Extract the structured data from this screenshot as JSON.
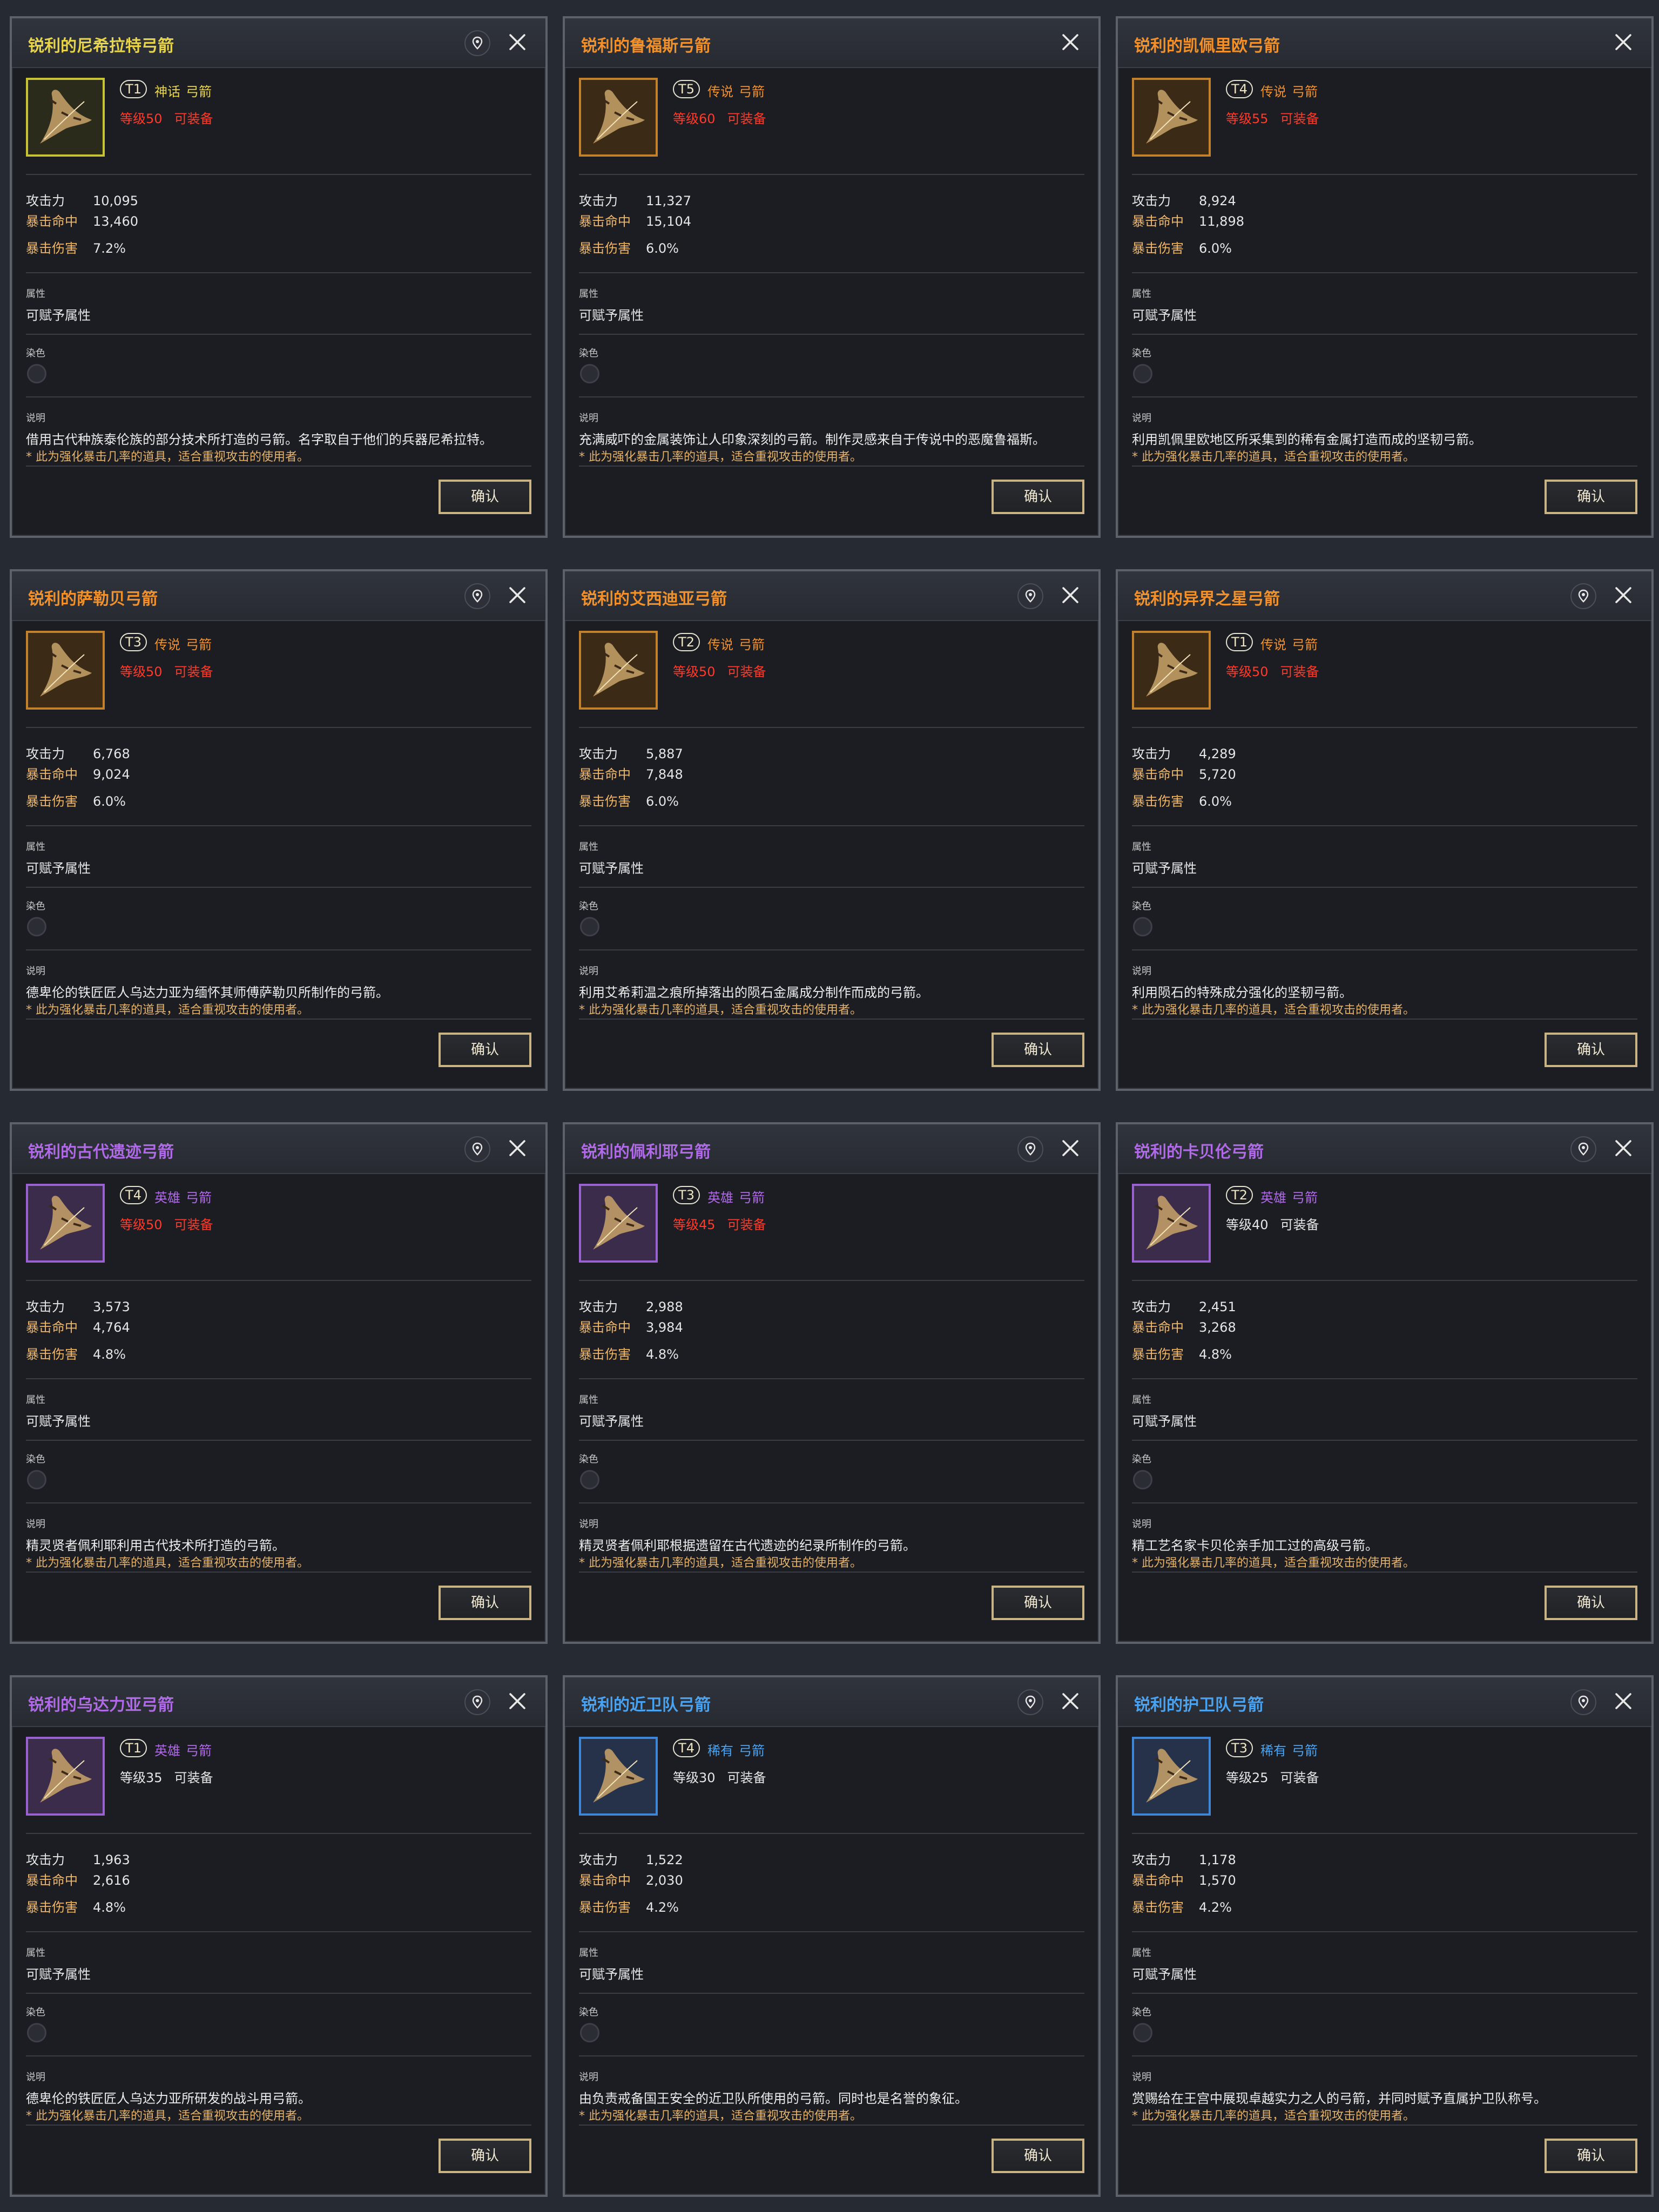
{
  "colors": {
    "mythic": "#e8d44a",
    "legendary": "#f2902a",
    "heroic": "#b06ae8",
    "rare": "#4aa3f0",
    "level_unmet": "#ff3a2a",
    "level_met": "#e6e6e6",
    "stat_atk": "#e6e6e6",
    "stat_crit": "#f0b768"
  },
  "labels": {
    "attack": "攻击力",
    "crit_hit": "暴击命中",
    "crit_damage": "暴击伤害",
    "property": "属性",
    "property_value": "可赋予属性",
    "dye": "染色",
    "description": "说明",
    "note": "* 此为强化暴击几率的道具，适合重视攻击的使用者。",
    "equippable": "可装备",
    "confirm": "确认",
    "type": "弓箭"
  },
  "icons": {
    "pin": "map-pin-icon",
    "close": "close-icon",
    "item": "bow-icon"
  },
  "cards": [
    {
      "title": "锐利的尼希拉特弓箭",
      "grade": "mythic",
      "tier": "T1",
      "grade_label": "神话",
      "level": "等级50",
      "level_met": false,
      "attack": "10,095",
      "crit_hit": "13,460",
      "crit_damage": "7.2%",
      "desc": "借用古代种族泰伦族的部分技术所打造的弓箭。名字取自于他们的兵器尼希拉特。",
      "pin": true
    },
    {
      "title": "锐利的鲁福斯弓箭",
      "grade": "legendary",
      "tier": "T5",
      "grade_label": "传说",
      "level": "等级60",
      "level_met": false,
      "attack": "11,327",
      "crit_hit": "15,104",
      "crit_damage": "6.0%",
      "desc": "充满威吓的金属装饰让人印象深刻的弓箭。制作灵感来自于传说中的恶魔鲁福斯。",
      "pin": false
    },
    {
      "title": "锐利的凯佩里欧弓箭",
      "grade": "legendary",
      "tier": "T4",
      "grade_label": "传说",
      "level": "等级55",
      "level_met": false,
      "attack": "8,924",
      "crit_hit": "11,898",
      "crit_damage": "6.0%",
      "desc": "利用凯佩里欧地区所采集到的稀有金属打造而成的坚韧弓箭。",
      "pin": false
    },
    {
      "title": "锐利的萨勒贝弓箭",
      "grade": "legendary",
      "tier": "T3",
      "grade_label": "传说",
      "level": "等级50",
      "level_met": false,
      "attack": "6,768",
      "crit_hit": "9,024",
      "crit_damage": "6.0%",
      "desc": "德卑伦的铁匠匠人乌达力亚为缅怀其师傅萨勒贝所制作的弓箭。",
      "pin": true
    },
    {
      "title": "锐利的艾西迪亚弓箭",
      "grade": "legendary",
      "tier": "T2",
      "grade_label": "传说",
      "level": "等级50",
      "level_met": false,
      "attack": "5,887",
      "crit_hit": "7,848",
      "crit_damage": "6.0%",
      "desc": "利用艾希莉温之痕所掉落出的陨石金属成分制作而成的弓箭。",
      "pin": true
    },
    {
      "title": "锐利的异界之星弓箭",
      "grade": "legendary",
      "tier": "T1",
      "grade_label": "传说",
      "level": "等级50",
      "level_met": false,
      "attack": "4,289",
      "crit_hit": "5,720",
      "crit_damage": "6.0%",
      "desc": "利用陨石的特殊成分强化的坚韧弓箭。",
      "pin": true
    },
    {
      "title": "锐利的古代遗迹弓箭",
      "grade": "heroic",
      "tier": "T4",
      "grade_label": "英雄",
      "level": "等级50",
      "level_met": false,
      "attack": "3,573",
      "crit_hit": "4,764",
      "crit_damage": "4.8%",
      "desc": "精灵贤者佩利耶利用古代技术所打造的弓箭。",
      "pin": true
    },
    {
      "title": "锐利的佩利耶弓箭",
      "grade": "heroic",
      "tier": "T3",
      "grade_label": "英雄",
      "level": "等级45",
      "level_met": false,
      "attack": "2,988",
      "crit_hit": "3,984",
      "crit_damage": "4.8%",
      "desc": "精灵贤者佩利耶根据遗留在古代遗迹的纪录所制作的弓箭。",
      "pin": true
    },
    {
      "title": "锐利的卡贝伦弓箭",
      "grade": "heroic",
      "tier": "T2",
      "grade_label": "英雄",
      "level": "等级40",
      "level_met": true,
      "attack": "2,451",
      "crit_hit": "3,268",
      "crit_damage": "4.8%",
      "desc": "精工艺名家卡贝伦亲手加工过的高级弓箭。",
      "pin": true
    },
    {
      "title": "锐利的乌达力亚弓箭",
      "grade": "heroic",
      "tier": "T1",
      "grade_label": "英雄",
      "level": "等级35",
      "level_met": true,
      "attack": "1,963",
      "crit_hit": "2,616",
      "crit_damage": "4.8%",
      "desc": "德卑伦的铁匠匠人乌达力亚所研发的战斗用弓箭。",
      "pin": true
    },
    {
      "title": "锐利的近卫队弓箭",
      "grade": "rare",
      "tier": "T4",
      "grade_label": "稀有",
      "level": "等级30",
      "level_met": true,
      "attack": "1,522",
      "crit_hit": "2,030",
      "crit_damage": "4.2%",
      "desc": "由负责戒备国王安全的近卫队所使用的弓箭。同时也是名誉的象征。",
      "pin": true
    },
    {
      "title": "锐利的护卫队弓箭",
      "grade": "rare",
      "tier": "T3",
      "grade_label": "稀有",
      "level": "等级25",
      "level_met": true,
      "attack": "1,178",
      "crit_hit": "1,570",
      "crit_damage": "4.2%",
      "desc": "赏赐给在王宫中展现卓越实力之人的弓箭，并同时赋予直属护卫队称号。",
      "pin": true
    }
  ]
}
